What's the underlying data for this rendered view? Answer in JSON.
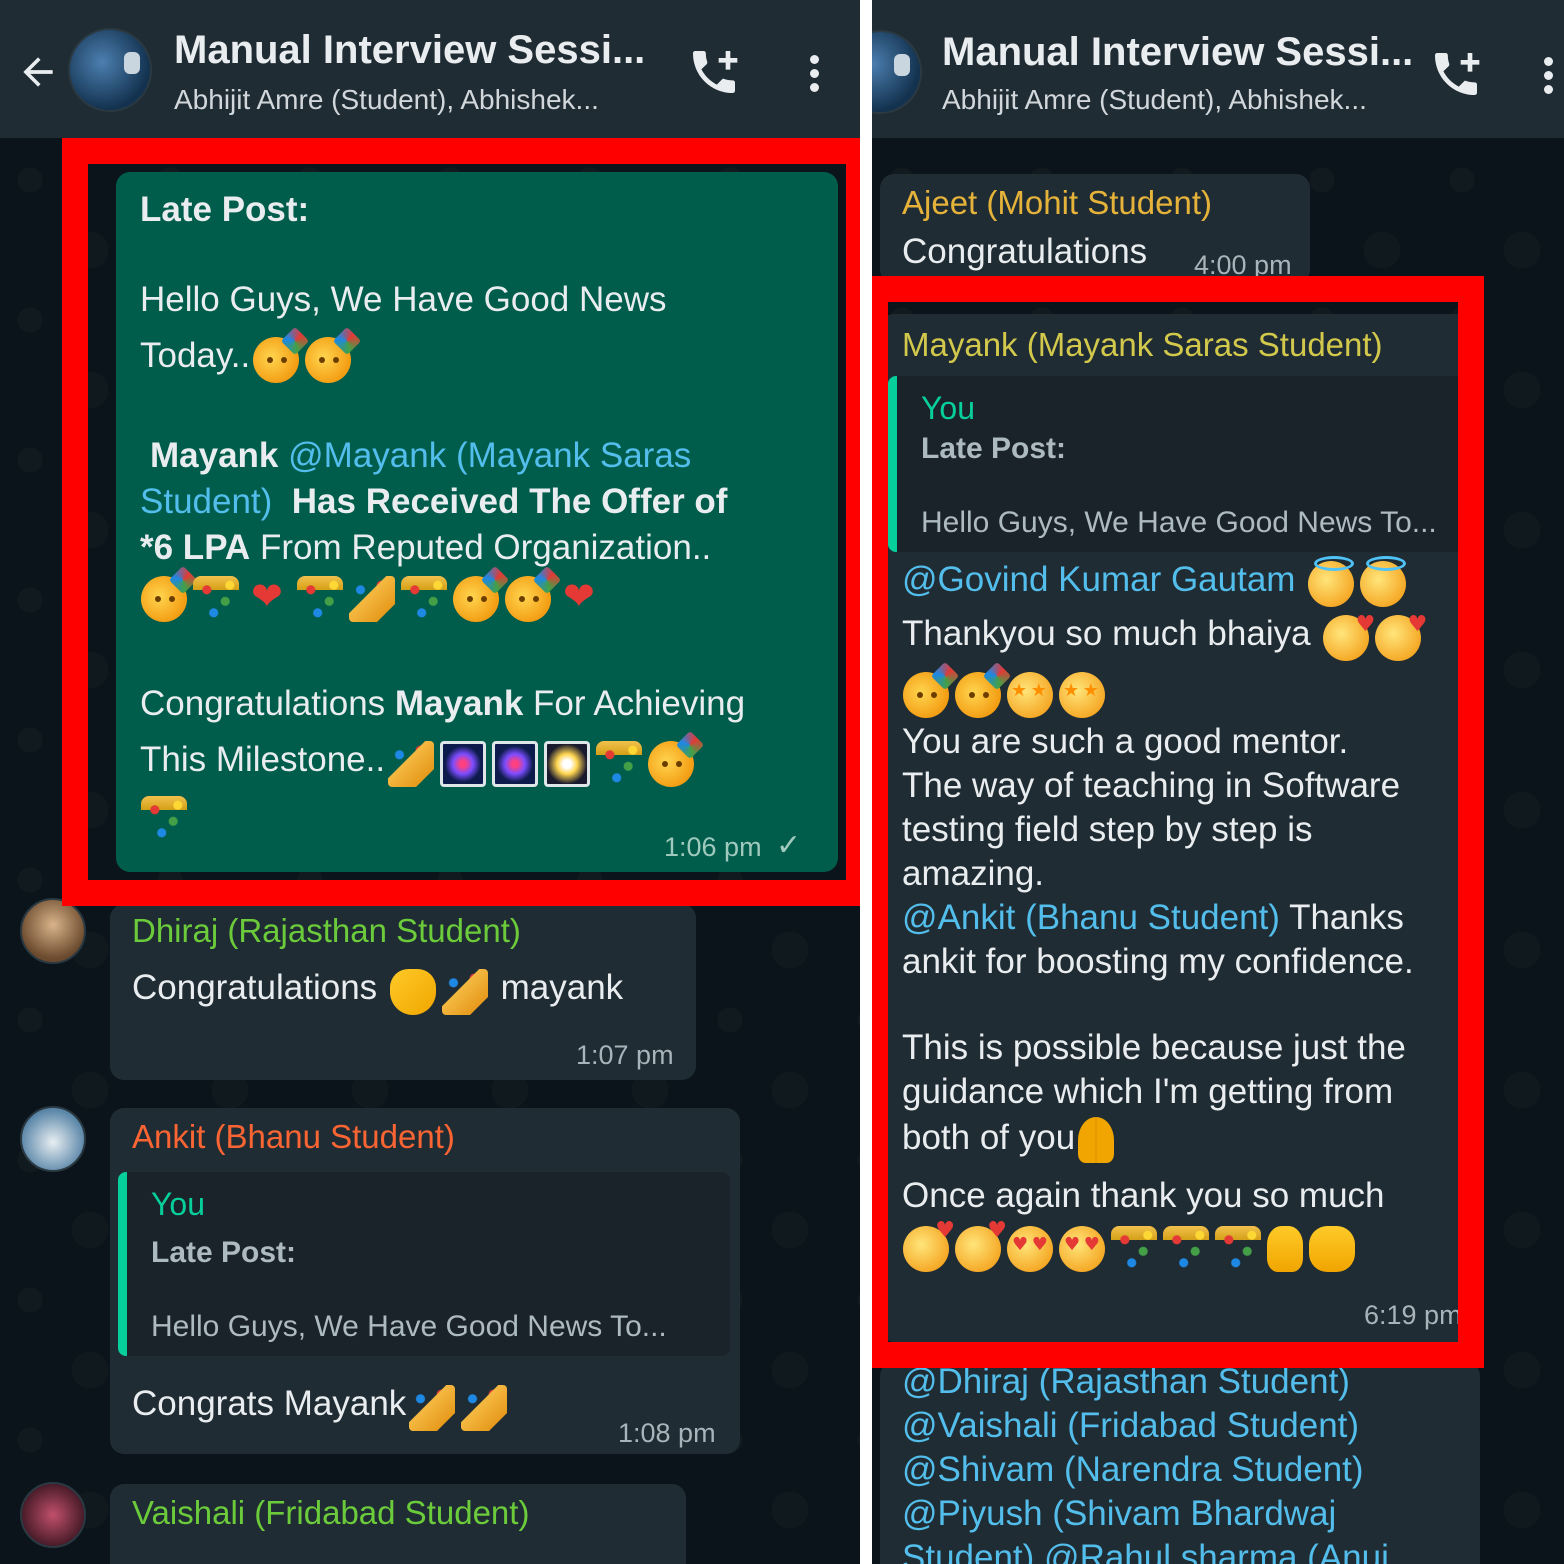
{
  "left": {
    "header": {
      "title": "Manual Interview Sessi...",
      "subtitle": "Abhijit Amre (Student), Abhishek..."
    },
    "post": {
      "late": "Late Post:",
      "line1": "Hello Guys, We Have Good News",
      "line2": "Today..",
      "mayank_bold": "Mayank",
      "mention_a": "@Mayank (Mayank Saras",
      "mention_b": "Student)",
      "offer_bold": "Has Received The Offer of",
      "lpa_bold": "*6 LPA",
      "offer_rest": "From Reputed Organization..",
      "congrats_a": "Congratulations",
      "congrats_name": "Mayank",
      "congrats_b": "For Achieving",
      "milestone": "This Milestone..",
      "time": "1:06 pm",
      "tick": "✓"
    },
    "msg_dhiraj": {
      "sender": "Dhiraj (Rajasthan Student)",
      "text_a": "Congratulations",
      "text_b": "mayank",
      "time": "1:07 pm"
    },
    "msg_ankit": {
      "sender": "Ankit (Bhanu Student)",
      "quote_you": "You",
      "quote_title": "Late Post:",
      "quote_text": "Hello Guys, We Have Good News To...",
      "text": "Congrats Mayank",
      "time": "1:08 pm"
    },
    "msg_vaishali": {
      "sender": "Vaishali (Fridabad Student)"
    }
  },
  "right": {
    "header": {
      "title": "Manual Interview Sessi...",
      "subtitle": "Abhijit Amre (Student), Abhishek..."
    },
    "msg_ajeet": {
      "sender": "Ajeet (Mohit Student)",
      "text": "Congratulations",
      "time": "4:00 pm"
    },
    "msg_mayank": {
      "sender": "Mayank (Mayank Saras Student)",
      "quote_you": "You",
      "quote_title": "Late Post:",
      "quote_text": "Hello Guys, We Have Good News To...",
      "mention1": "@Govind Kumar Gautam",
      "line_thanks": "Thankyou so much bhaiya",
      "line3": "You are such a good mentor.",
      "line4": "The way of teaching in Software",
      "line5": "testing field step by step is",
      "line6": "amazing.",
      "mention2": "@Ankit (Bhanu Student)",
      "line7_rest": "Thanks",
      "line8": "ankit for boosting my confidence.",
      "line9": "This is possible because just the",
      "line10": "guidance which I'm getting from",
      "line11": "both of you",
      "line12": "Once again thank you so much",
      "time": "6:19 pm"
    },
    "msg_next": {
      "m1": "@Dhiraj (Rajasthan Student)",
      "m2": "@Vaishali (Fridabad Student)",
      "m3": "@Shivam (Narendra Student)",
      "m4": "@Piyush (Shivam Bhardwaj",
      "m5": "Student) @Rahul sharma (Anuj"
    }
  },
  "colors": {
    "header_bg": "#202c33",
    "incoming_bubble": "#202c33",
    "outgoing_bubble": "#005c4b",
    "mention": "#53bdeb",
    "highlight_box": "#ff0000",
    "sender_green": "#6bcb3b",
    "sender_orange": "#fa6533",
    "sender_yellow": "#e5b23a",
    "sender_lime": "#d2c94c"
  },
  "icons": [
    "back-arrow-icon",
    "group-avatar",
    "add-call-icon",
    "more-vert-icon",
    "double-tick-icon"
  ]
}
